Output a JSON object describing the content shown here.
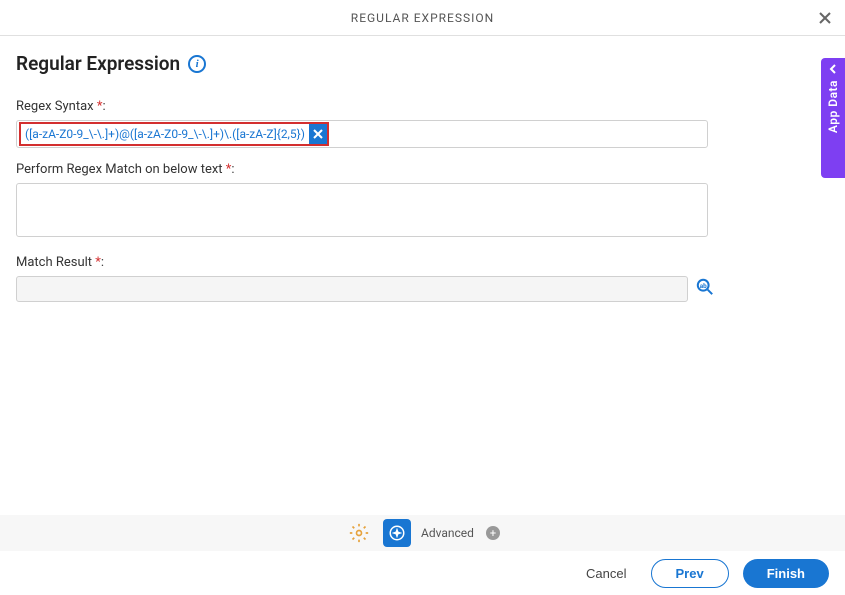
{
  "header": {
    "title": "REGULAR EXPRESSION"
  },
  "page": {
    "title": "Regular Expression"
  },
  "fields": {
    "regex": {
      "label": "Regex Syntax ",
      "value": "([a-zA-Z0-9_\\-\\.]+)@([a-zA-Z0-9_\\-\\.]+)\\.([a-zA-Z]{2,5})"
    },
    "perform": {
      "label": "Perform Regex Match on below text ",
      "value": ""
    },
    "match": {
      "label": "Match Result ",
      "value": ""
    }
  },
  "bottombar": {
    "advanced": "Advanced"
  },
  "actions": {
    "cancel": "Cancel",
    "prev": "Prev",
    "finish": "Finish"
  },
  "sidetab": {
    "label": "App Data"
  }
}
